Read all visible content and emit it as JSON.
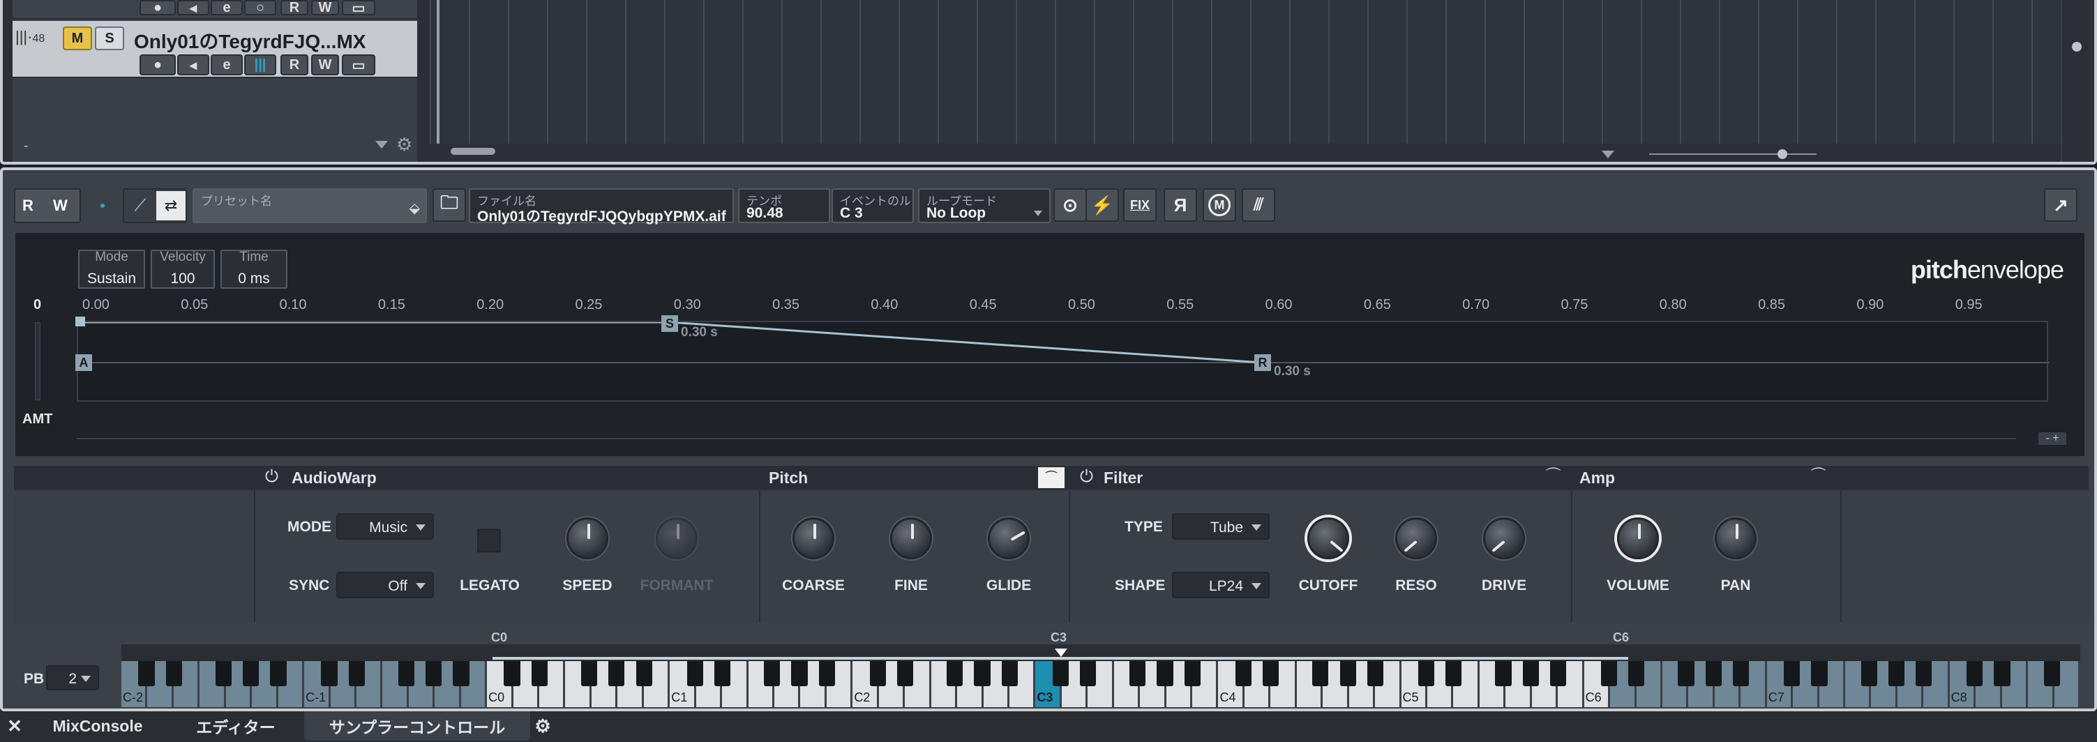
{
  "tracks": [
    {
      "number": "",
      "name": "",
      "selected": false
    },
    {
      "number": "48",
      "name": "Only01のTegyrdFJQ...MX",
      "selected": true,
      "mute": "M",
      "solo": "S"
    }
  ],
  "track_buttons": {
    "read": "R",
    "write": "W",
    "edit": "e"
  },
  "tracklist_footer": {
    "minus": "-"
  },
  "toolbar": {
    "read": "R",
    "write": "W",
    "preset_label": "プリセット名",
    "file_label": "ファイル名",
    "file_value": "Only01のTegyrdFJQQybgpYPMX.aif",
    "tempo_label": "テンポ",
    "tempo_value": "90.48",
    "event_label": "イベントのル",
    "event_value": "C  3",
    "loop_label": "ループモード",
    "loop_value": "No Loop",
    "fix_label": "FIX",
    "reverse_label": "R",
    "mono_label": "M"
  },
  "envelope": {
    "mode_label": "Mode",
    "mode_value": "Sustain",
    "velocity_label": "Velocity",
    "velocity_value": "100",
    "time_label": "Time",
    "time_value": "0 ms",
    "logo_bold": "pitch",
    "logo_rest": "envelope",
    "zero_label": "0",
    "amt_label": "AMT",
    "ticks": [
      "0.00",
      "0.05",
      "0.10",
      "0.15",
      "0.20",
      "0.25",
      "0.30",
      "0.35",
      "0.40",
      "0.45",
      "0.50",
      "0.55",
      "0.60",
      "0.65",
      "0.70",
      "0.75",
      "0.80",
      "0.85",
      "0.90",
      "0.95"
    ],
    "points": [
      {
        "label": "A",
        "time": "0.00",
        "level": 0
      },
      {
        "label": "S",
        "time": "0.30 s",
        "level": 1
      },
      {
        "label": "R",
        "time": "0.30 s",
        "level": 0
      }
    ],
    "s_time": "0.30 s",
    "r_time": "0.30 s"
  },
  "sections": {
    "audiowarp": {
      "title": "AudioWarp",
      "mode_label": "MODE",
      "mode_value": "Music",
      "sync_label": "SYNC",
      "sync_value": "Off",
      "legato": "LEGATO",
      "speed": "SPEED",
      "formant": "FORMANT"
    },
    "pitch": {
      "title": "Pitch",
      "coarse": "COARSE",
      "fine": "FINE",
      "glide": "GLIDE"
    },
    "filter": {
      "title": "Filter",
      "type_label": "TYPE",
      "type_value": "Tube",
      "shape_label": "SHAPE",
      "shape_value": "LP24",
      "cutoff": "CUTOFF",
      "reso": "RESO",
      "drive": "DRIVE"
    },
    "amp": {
      "title": "Amp",
      "volume": "VOLUME",
      "pan": "PAN"
    }
  },
  "keyboard": {
    "pb_label": "PB",
    "pb_value": "2",
    "range_low": "C0",
    "range_root": "C3",
    "range_high": "C6",
    "octaves": [
      "C-2",
      "C-1",
      "C0",
      "C1",
      "C2",
      "C3",
      "C4",
      "C5",
      "C6",
      "C7",
      "C8"
    ]
  },
  "bottom_tabs": [
    "MixConsole",
    "エディター",
    "サンプラーコントロール"
  ],
  "colors": {
    "accent_blue": "#2aa3c8",
    "mute_yellow": "#e6c24a",
    "key_highlight": "#1d8fb0"
  }
}
